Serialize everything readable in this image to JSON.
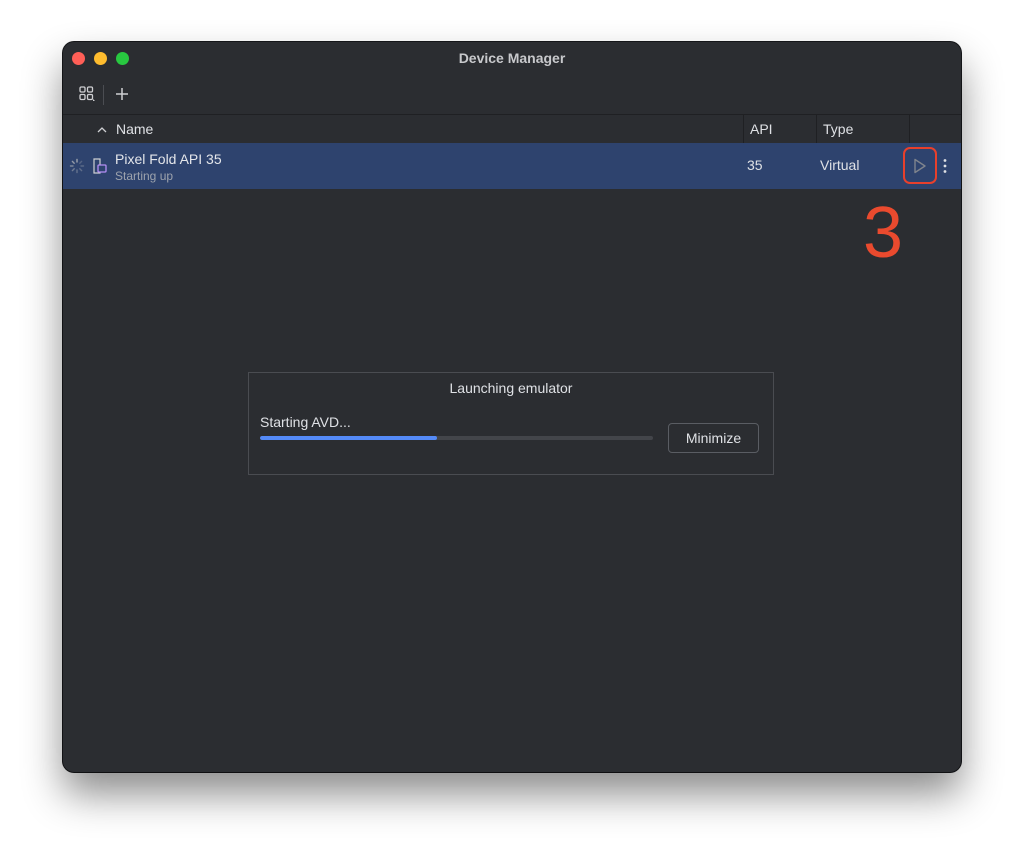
{
  "window": {
    "title": "Device Manager"
  },
  "toolbar": {
    "items": [
      {
        "icon": "device-grid-icon"
      },
      {
        "icon": "plus-icon",
        "label": "+"
      }
    ]
  },
  "table": {
    "sort_icon": "chevron-up-icon",
    "columns": [
      "Name",
      "API",
      "Type"
    ],
    "rows": [
      {
        "name": "Pixel Fold API 35",
        "status": "Starting up",
        "api": "35",
        "type": "Virtual",
        "icons": [
          "loading-spinner-icon",
          "foldable-device-icon",
          "play-icon",
          "more-vert-icon"
        ],
        "selected": true
      }
    ]
  },
  "annotation": {
    "number": "3",
    "color": "#ea4a2e"
  },
  "dialog": {
    "title": "Launching emulator",
    "status": "Starting AVD...",
    "progress_percent": 45,
    "button_label": "Minimize"
  },
  "colors": {
    "window_bg": "#2b2d31",
    "selected_row": "#2e436e",
    "accent": "#548af7",
    "highlight": "#e8402c"
  }
}
